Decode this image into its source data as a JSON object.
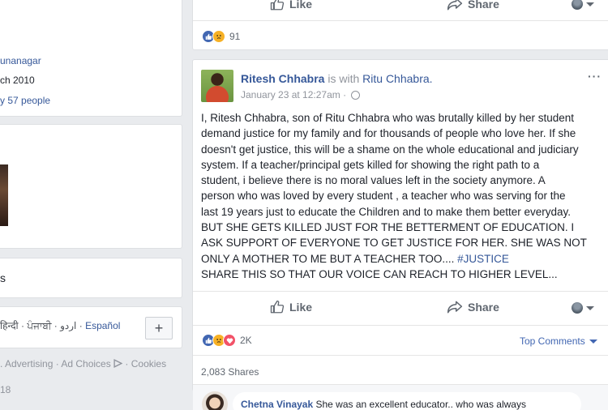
{
  "left": {
    "place": "unanagar",
    "since": "ch 2010",
    "liked_by": "y 57 people",
    "close_letter": "s",
    "languages": "हिन्दी · ਪੰਜਾਬੀ · اردو · ",
    "lang_link": "Español",
    "plus_label": "+",
    "footer_links": ". Advertising · Ad Choices",
    "cookies": " · Cookies",
    "year": "18"
  },
  "prev_post": {
    "like_label": "Like",
    "share_label": "Share",
    "reaction_count": "91"
  },
  "post": {
    "author": "Ritesh Chhabra",
    "with_text": "is with",
    "tagged": "Ritu Chhabra.",
    "time": "January 23 at 12:27am",
    "separator": "·",
    "body_lines": [
      "I, Ritesh Chhabra, son of Ritu Chhabra who was brutally killed by her student",
      "demand justice for my family and for thousands of people who love her. If she",
      "doesn't get justice, this will be a shame on the whole educational and judiciary",
      "system. If a teacher/principal gets killed for showing the right path to a",
      "student, i believe there is no moral values left in the society anymore. A",
      "person who was loved by every student , a teacher who was serving for the",
      "last 19 years just to educate the Children and to make them better everyday.",
      "BUT SHE GETS KILLED JUST FOR THE BETTERMENT OF EDUCATION. I",
      "ASK SUPPORT OF EVERYONE TO GET JUSTICE FOR HER. SHE WAS NOT"
    ],
    "body_line_last_prefix": "ONLY A MOTHER TO ME BUT A TEACHER TOO.... ",
    "hashtag": "#JUSTICE",
    "body_share_line": "SHARE THIS SO THAT OUR VOICE CAN REACH TO HIGHER LEVEL...",
    "like_label": "Like",
    "share_label": "Share",
    "reaction_count": "2K",
    "sort_label": "Top Comments",
    "shares": "2,083 Shares",
    "more": "···"
  },
  "comment": {
    "author": "Chetna Vinayak",
    "text": "She was an excellent educator.. who was always"
  },
  "colors": {
    "like_blue": "#4267b2",
    "sad_yellow": "#f7b125",
    "love_red": "#f25268",
    "link_blue": "#365899"
  }
}
